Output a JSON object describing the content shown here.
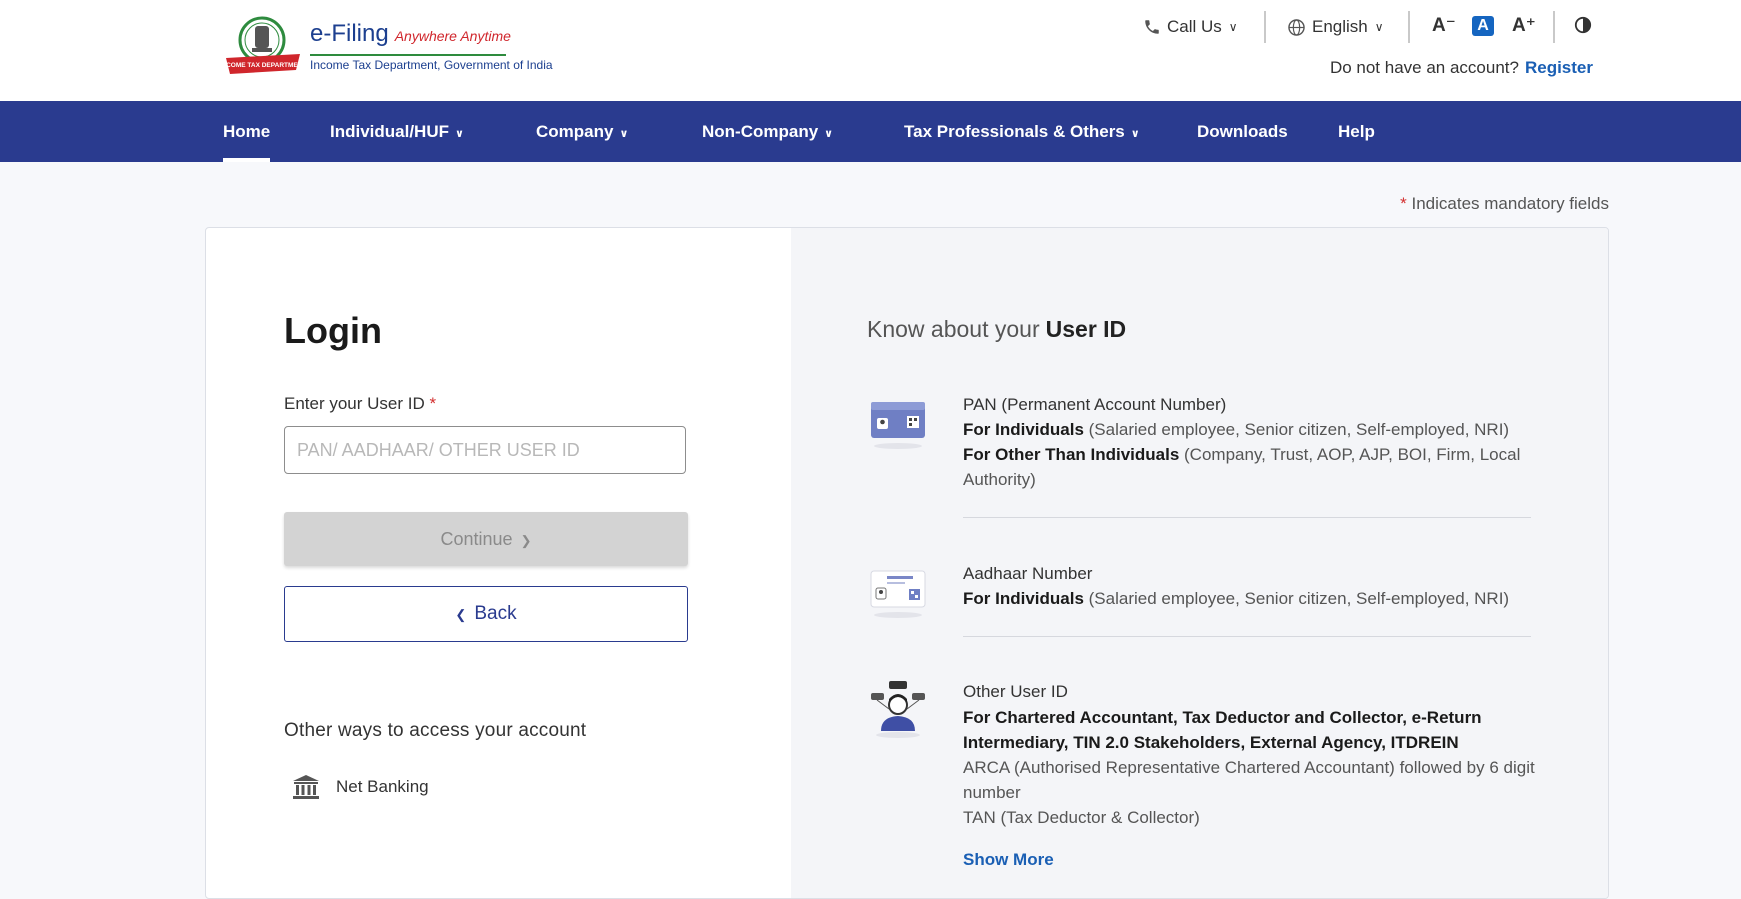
{
  "header": {
    "brand": "e-Filing",
    "tagline": "Anywhere Anytime",
    "department": "Income Tax Department, Government of India",
    "call_us": "Call Us",
    "language": "English",
    "font_decrease": "A⁻",
    "font_default": "A",
    "font_increase": "A⁺",
    "no_account_text": "Do not have an account?",
    "register": "Register"
  },
  "nav": {
    "items": [
      {
        "label": "Home",
        "dropdown": false,
        "active": true
      },
      {
        "label": "Individual/HUF",
        "dropdown": true
      },
      {
        "label": "Company",
        "dropdown": true
      },
      {
        "label": "Non-Company",
        "dropdown": true
      },
      {
        "label": "Tax Professionals & Others",
        "dropdown": true
      },
      {
        "label": "Downloads",
        "dropdown": false
      },
      {
        "label": "Help",
        "dropdown": false
      }
    ]
  },
  "mandatory_note": {
    "star": "*",
    "text": "Indicates mandatory fields"
  },
  "login": {
    "title": "Login",
    "userid_label": "Enter your User ID",
    "required_star": "*",
    "userid_value": "",
    "userid_placeholder": "PAN/ AADHAAR/ OTHER USER ID",
    "continue": "Continue",
    "back": "Back",
    "other_ways": "Other ways to access your account",
    "net_banking": "Net Banking"
  },
  "know": {
    "title_prefix": "Know about your",
    "title_bold": "User ID",
    "pan": {
      "head": "PAN (Permanent Account Number)",
      "line1_bold": "For Individuals",
      "line1_rest": " (Salaried employee, Senior citizen, Self-employed, NRI)",
      "line2_bold": "For Other Than Individuals",
      "line2_rest": " (Company, Trust, AOP, AJP, BOI, Firm, Local Authority)"
    },
    "aadhaar": {
      "head": "Aadhaar Number",
      "line1_bold": "For Individuals",
      "line1_rest": " (Salaried employee, Senior citizen, Self-employed, NRI)"
    },
    "other": {
      "head": "Other User ID",
      "bold": "For Chartered Accountant, Tax Deductor and Collector, e-Return Intermediary, TIN 2.0 Stakeholders, External Agency, ITDREIN",
      "line1": "ARCA (Authorised Representative Chartered Accountant) followed by 6 digit number",
      "line2": "TAN (Tax Deductor & Collector)"
    },
    "show_more": "Show More"
  },
  "colors": {
    "nav_bg": "#2a3b8f",
    "link": "#1a5fb4",
    "required": "#d32f2f",
    "disabled_btn": "#d3d3d3"
  }
}
